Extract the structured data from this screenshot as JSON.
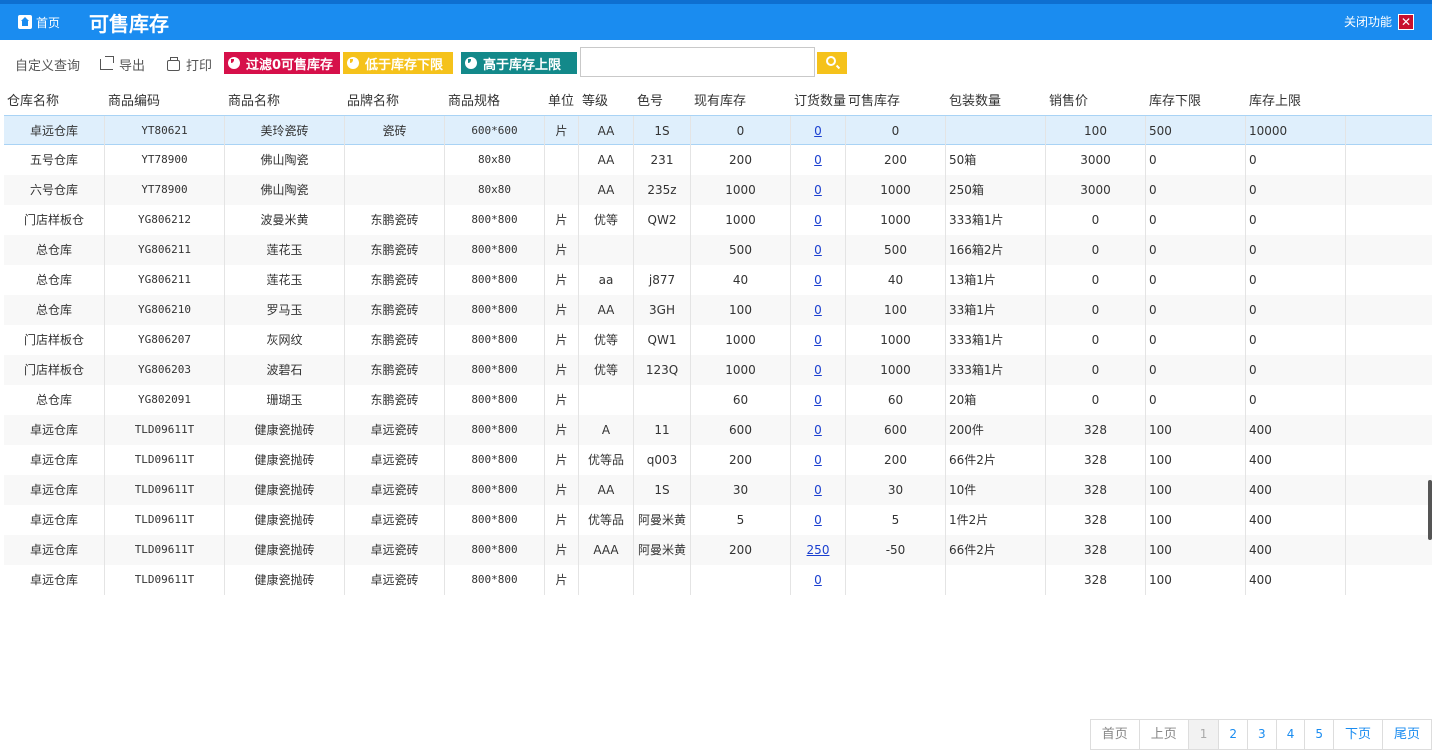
{
  "header": {
    "home_label": "首页",
    "title": "可售库存",
    "close_label": "关闭功能"
  },
  "toolbar": {
    "custom_query": "自定义查询",
    "export": "导出",
    "print": "打印",
    "filter_zero": "过滤0可售库存",
    "below_min": "低于库存下限",
    "above_max": "高于库存上限",
    "search_value": ""
  },
  "columns": [
    "仓库名称",
    "商品编码",
    "商品名称",
    "品牌名称",
    "商品规格",
    "单位",
    "等级",
    "色号",
    "现有库存",
    "订货数量",
    "可售库存",
    "包装数量",
    "销售价",
    "库存下限",
    "库存上限"
  ],
  "rows": [
    [
      "卓远仓库",
      "YT80621",
      "美玲瓷砖",
      "瓷砖",
      "600*600",
      "片",
      "AA",
      "1S",
      "0",
      "0",
      "0",
      "",
      "100",
      "500",
      "10000"
    ],
    [
      "五号仓库",
      "YT78900",
      "佛山陶瓷",
      "",
      "80x80",
      "",
      "AA",
      "231",
      "200",
      "0",
      "200",
      "50箱",
      "3000",
      "0",
      "0"
    ],
    [
      "六号仓库",
      "YT78900",
      "佛山陶瓷",
      "",
      "80x80",
      "",
      "AA",
      "235z",
      "1000",
      "0",
      "1000",
      "250箱",
      "3000",
      "0",
      "0"
    ],
    [
      "门店样板仓",
      "YG806212",
      "波曼米黄",
      "东鹏瓷砖",
      "800*800",
      "片",
      "优等",
      "QW2",
      "1000",
      "0",
      "1000",
      "333箱1片",
      "0",
      "0",
      "0"
    ],
    [
      "总仓库",
      "YG806211",
      "莲花玉",
      "东鹏瓷砖",
      "800*800",
      "片",
      "",
      "",
      "500",
      "0",
      "500",
      "166箱2片",
      "0",
      "0",
      "0"
    ],
    [
      "总仓库",
      "YG806211",
      "莲花玉",
      "东鹏瓷砖",
      "800*800",
      "片",
      "aa",
      "j877",
      "40",
      "0",
      "40",
      "13箱1片",
      "0",
      "0",
      "0"
    ],
    [
      "总仓库",
      "YG806210",
      "罗马玉",
      "东鹏瓷砖",
      "800*800",
      "片",
      "AA",
      "3GH",
      "100",
      "0",
      "100",
      "33箱1片",
      "0",
      "0",
      "0"
    ],
    [
      "门店样板仓",
      "YG806207",
      "灰网纹",
      "东鹏瓷砖",
      "800*800",
      "片",
      "优等",
      "QW1",
      "1000",
      "0",
      "1000",
      "333箱1片",
      "0",
      "0",
      "0"
    ],
    [
      "门店样板仓",
      "YG806203",
      "波碧石",
      "东鹏瓷砖",
      "800*800",
      "片",
      "优等",
      "123Q",
      "1000",
      "0",
      "1000",
      "333箱1片",
      "0",
      "0",
      "0"
    ],
    [
      "总仓库",
      "YG802091",
      "珊瑚玉",
      "东鹏瓷砖",
      "800*800",
      "片",
      "",
      "",
      "60",
      "0",
      "60",
      "20箱",
      "0",
      "0",
      "0"
    ],
    [
      "卓远仓库",
      "TLD09611T",
      "健康瓷抛砖",
      "卓远瓷砖",
      "800*800",
      "片",
      "A",
      "11",
      "600",
      "0",
      "600",
      "200件",
      "328",
      "100",
      "400"
    ],
    [
      "卓远仓库",
      "TLD09611T",
      "健康瓷抛砖",
      "卓远瓷砖",
      "800*800",
      "片",
      "优等品",
      "q003",
      "200",
      "0",
      "200",
      "66件2片",
      "328",
      "100",
      "400"
    ],
    [
      "卓远仓库",
      "TLD09611T",
      "健康瓷抛砖",
      "卓远瓷砖",
      "800*800",
      "片",
      "AA",
      "1S",
      "30",
      "0",
      "30",
      "10件",
      "328",
      "100",
      "400"
    ],
    [
      "卓远仓库",
      "TLD09611T",
      "健康瓷抛砖",
      "卓远瓷砖",
      "800*800",
      "片",
      "优等品",
      "阿曼米黄",
      "5",
      "0",
      "5",
      "1件2片",
      "328",
      "100",
      "400"
    ],
    [
      "卓远仓库",
      "TLD09611T",
      "健康瓷抛砖",
      "卓远瓷砖",
      "800*800",
      "片",
      "AAA",
      "阿曼米黄",
      "200",
      "250",
      "-50",
      "66件2片",
      "328",
      "100",
      "400"
    ],
    [
      "卓远仓库",
      "TLD09611T",
      "健康瓷抛砖",
      "卓远瓷砖",
      "800*800",
      "片",
      "",
      "",
      "",
      "0",
      "",
      "",
      "328",
      "100",
      "400"
    ]
  ],
  "pager": {
    "first": "首页",
    "prev": "上页",
    "pages": [
      "1",
      "2",
      "3",
      "4",
      "5"
    ],
    "current": "1",
    "next": "下页",
    "last": "尾页"
  },
  "colors": {
    "header_bg": "#1a8cf0",
    "filter_red": "#d6104a",
    "filter_yellow": "#f5c21b",
    "filter_teal": "#13898a",
    "selected_row": "#dfeffc",
    "link": "#1a3fd0"
  }
}
